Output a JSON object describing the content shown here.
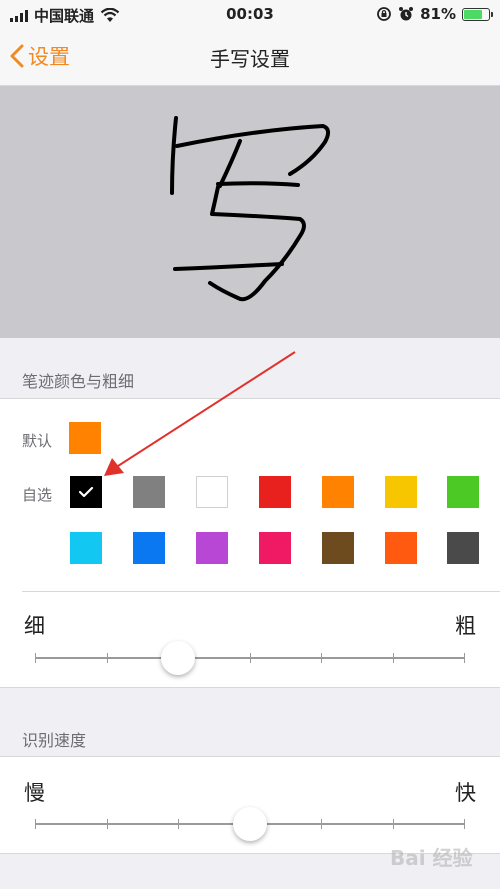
{
  "status": {
    "carrier": "中国联通",
    "time": "00:03",
    "battery_percent": "81%",
    "battery_level": 0.81
  },
  "nav": {
    "back_label": "设置",
    "title": "手写设置"
  },
  "stroke_section": {
    "header": "笔迹颜色与粗细",
    "default_label": "默认",
    "custom_label": "自选",
    "default_color": "#ff8200",
    "custom_colors_row1": [
      "#000000",
      "#808080",
      "#ffffff",
      "#e8211f",
      "#ff8200",
      "#f7c600",
      "#4cc924"
    ],
    "custom_colors_row2": [
      "#12c8f2",
      "#0a78f0",
      "#b847d6",
      "#f01a64",
      "#6e4a1f",
      "#ff5a10",
      "#4a4a4a"
    ],
    "selected_color": "#000000",
    "thin_label": "细",
    "thick_label": "粗",
    "thickness_level": 0.333
  },
  "speed_section": {
    "header": "识别速度",
    "slow_label": "慢",
    "fast_label": "快",
    "speed_level": 0.5
  },
  "watermark": "Bai 经验",
  "colors": {
    "accent": "#f08a24",
    "arrow": "#e0322b"
  },
  "icons": {
    "back": "chevron-left-icon",
    "wifi": "wifi-icon",
    "lock": "rotation-lock-icon",
    "alarm": "alarm-icon",
    "battery": "battery-charging-icon",
    "check": "checkmark-icon"
  }
}
